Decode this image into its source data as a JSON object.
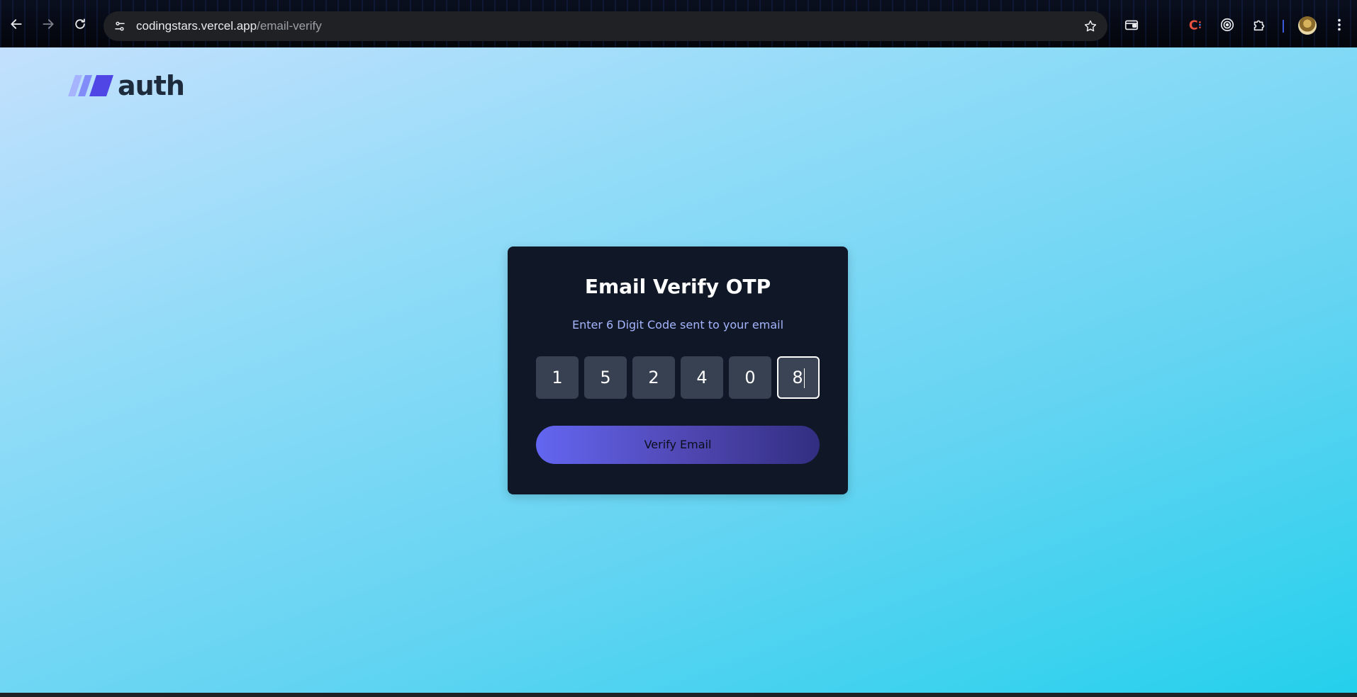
{
  "browser": {
    "url_domain": "codingstars.vercel.app",
    "url_path": "/email-verify",
    "icons": {
      "back": "arrow-left-icon",
      "forward": "arrow-right-icon",
      "reload": "reload-icon",
      "site_info": "tune-icon",
      "bookmark": "star-icon",
      "wallet": "wallet-icon",
      "extension_c": "c-extension-icon",
      "target": "target-icon",
      "extensions": "puzzle-icon",
      "profile": "avatar",
      "menu": "kebab-menu-icon"
    }
  },
  "header": {
    "logo_text": "auth",
    "logo_colors": [
      "#a5b4fc",
      "#818cf8",
      "#4f46e5"
    ]
  },
  "card": {
    "title": "Email Verify OTP",
    "subtitle": "Enter 6 Digit Code sent to your email",
    "otp_digits": [
      "1",
      "5",
      "2",
      "4",
      "0",
      "8"
    ],
    "active_index": 5,
    "button_label": "Verify Email"
  },
  "colors": {
    "card_bg": "#101828",
    "otp_bg": "#374151",
    "subtitle": "#a5b4fc",
    "button_start": "#6366f1",
    "button_end": "#312e81"
  }
}
